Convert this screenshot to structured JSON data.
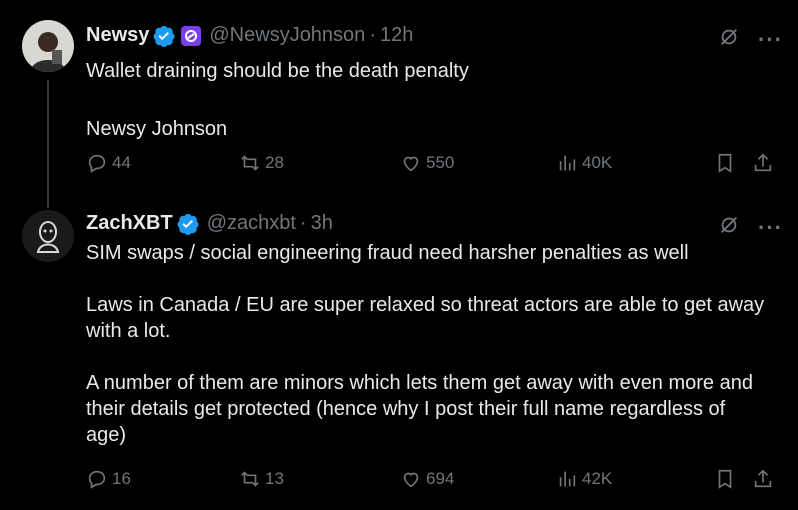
{
  "tweets": [
    {
      "author_name": "Newsy",
      "handle": "@NewsyJohnson",
      "separator": "·",
      "time": "12h",
      "lines": [
        "Wallet draining should be the death penalty",
        "",
        "Newsy Johnson"
      ],
      "stats": {
        "replies": "44",
        "retweets": "28",
        "likes": "550",
        "views": "40K"
      }
    },
    {
      "author_name": "ZachXBT",
      "handle": "@zachxbt",
      "separator": "·",
      "time": "3h",
      "lines": [
        "SIM swaps / social engineering fraud need harsher penalties as well",
        "",
        "Laws in Canada / EU are super relaxed so threat actors are able to get away",
        "with a lot.",
        "",
        "A number of them are minors which lets them get away with even more and",
        "their details get protected (hence why I post their full name regardless of",
        "age)"
      ],
      "stats": {
        "replies": "16",
        "retweets": "13",
        "likes": "694",
        "views": "42K"
      }
    }
  ],
  "colors": {
    "verified": "#1d9bf0",
    "muted": "#71767b",
    "text": "#e7e9ea",
    "background": "#000000"
  },
  "icons": [
    "verified-icon",
    "affiliate-badge-icon",
    "grok-icon",
    "more-icon",
    "reply-icon",
    "retweet-icon",
    "like-icon",
    "views-icon",
    "bookmark-icon",
    "share-icon"
  ]
}
